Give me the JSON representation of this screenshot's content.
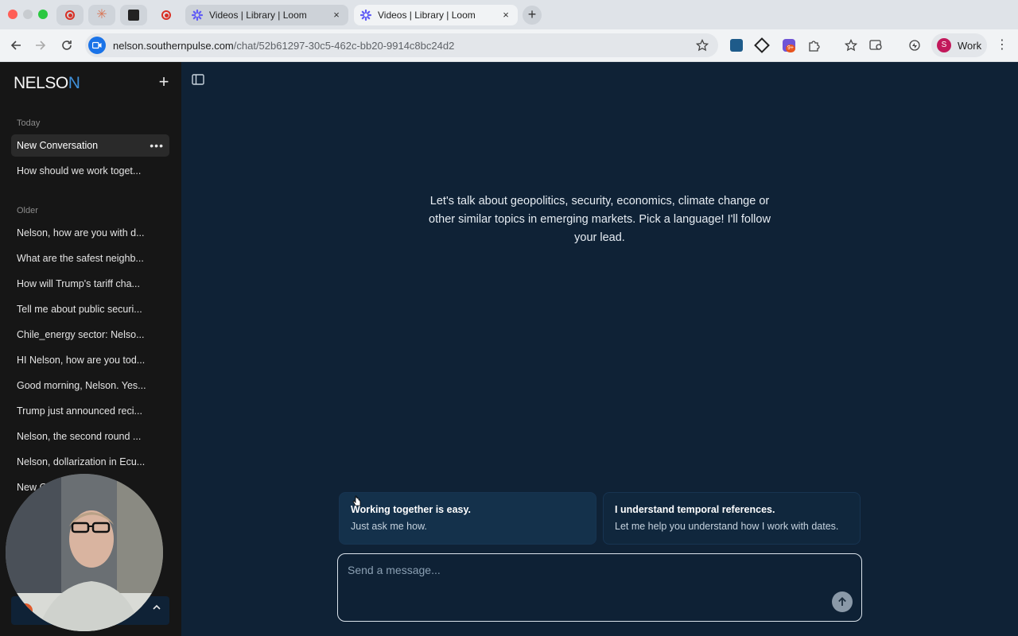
{
  "browser": {
    "tabs": [
      {
        "title": "Videos | Library | Loom",
        "close": "×"
      },
      {
        "title": "Videos | Library | Loom",
        "close": "×"
      }
    ],
    "new_tab": "+",
    "url_host": "nelson.southernpulse.com",
    "url_path": "/chat/52b61297-30c5-462c-bb20-9914c8bc24d2",
    "extension_badge": "9+",
    "profile_initial": "S",
    "profile_label": "Work",
    "colors": {
      "chrome": "#dfe3e8",
      "toolbar": "#f1f3f5",
      "profile": "#c2185b",
      "site_icon": "#1a73e8"
    }
  },
  "app": {
    "logo_text": "NELSO",
    "logo_accent": "N",
    "new_chat_symbol": "+",
    "sections": {
      "today_label": "Today",
      "older_label": "Older"
    },
    "today": [
      {
        "label": "New Conversation",
        "active": true,
        "more": "•••"
      },
      {
        "label": "How should we work toget..."
      }
    ],
    "older": [
      {
        "label": "Nelson, how are you with d..."
      },
      {
        "label": "What are the safest neighb..."
      },
      {
        "label": "How will Trump's tariff cha..."
      },
      {
        "label": "Tell me about public securi..."
      },
      {
        "label": "Chile_energy sector: Nelso..."
      },
      {
        "label": "HI Nelson, how are you tod..."
      },
      {
        "label": "Good morning, Nelson. Yes..."
      },
      {
        "label": "Trump just announced reci..."
      },
      {
        "label": "Nelson, the second round ..."
      },
      {
        "label": "Nelson, dollarization in Ecu..."
      },
      {
        "label": "New C"
      }
    ],
    "colors": {
      "sidebar": "#161616",
      "main": "#0f2236",
      "accent": "#3f8fd8"
    }
  },
  "main": {
    "welcome": "Let's talk about geopolitics, security, economics, climate change or other similar topics in emerging markets. Pick a language! I'll follow your lead.",
    "suggestions": [
      {
        "title": "Working together is easy.",
        "subtitle": "Just ask me how."
      },
      {
        "title": "I understand temporal references.",
        "subtitle": "Let me help you understand how I work with dates."
      }
    ],
    "composer_placeholder": "Send a message..."
  }
}
